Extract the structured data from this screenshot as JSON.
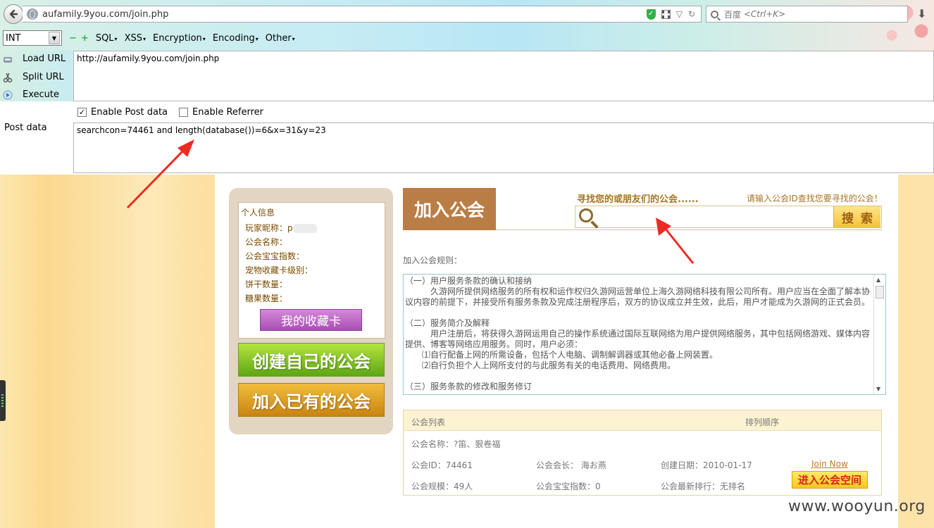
{
  "browser": {
    "url": "aufamily.9you.com/join.php",
    "search_placeholder_prefix": "百度",
    "search_placeholder_shortcut": "<Ctrl+K>"
  },
  "hackbar": {
    "select_value": "INT",
    "menus": [
      "SQL",
      "XSS",
      "Encryption",
      "Encoding",
      "Other"
    ],
    "load_url": "Load URL",
    "split_url": "Split URL",
    "execute": "Execute",
    "url_value": "http://aufamily.9you.com/join.php",
    "enable_post": "Enable Post data",
    "enable_referrer": "Enable Referrer",
    "post_label": "Post data",
    "post_value": "searchcon=74461 and length(database())=6&x=31&y=23",
    "enable_post_checked": true,
    "enable_referrer_checked": false
  },
  "left_panel": {
    "title": "个人信息",
    "nickname_label": "玩家昵称：",
    "nickname_value": "p",
    "guild_name": "公会名称：",
    "guild_baby_index": "公会宝宝指数：",
    "pet_card_level": "宠物收藏卡级别：",
    "biscuits": "饼干数量：",
    "candies": "糖果数量：",
    "my_card_button": "我的收藏卡",
    "create_guild_button": "创建自己的公会",
    "join_guild_button": "加入已有的公会"
  },
  "header": {
    "title": "加入公会",
    "find_text": "寻找您的或朋友们的公会......",
    "hint_text": "请输入公会ID查找您要寻找的公会！",
    "search_button": "搜索"
  },
  "rules": {
    "label": "加入公会规则：",
    "lines": [
      "（一）用户服务条款的确认和接纳",
      "　　　久游网所提供网络服务的所有权和运作权归久游网运营单位上海久游网络科技有限公司所有。用户应当在全面了解本协议内容的前提下，并接受所有服务条款及完成注册程序后，双方的协议成立并生效，此后，用户才能成为久游网的正式会员。",
      "",
      "（二）服务简介及解释",
      "　　　用户注册后，将获得久游网运用自己的操作系统通过国际互联网络为用户提供网络服务，其中包括网络游戏、媒体内容提供、博客等网络应用服务。同时，用户必须：",
      "　　⑴自行配备上网的所需设备，包括个人电脑、调制解调器或其他必备上网装置。",
      "　　⑵自行负担个人上网所支付的与此服务有关的电话费用、网络费用。",
      "",
      "（三）服务条款的修改和服务修订"
    ]
  },
  "guild_list": {
    "col_list": "公会列表",
    "col_order": "排列顺序",
    "name": "公会名称：?笛、狠卷福",
    "id": "公会ID：74461",
    "leader": "公会会长： 海お燕",
    "created": "创建日期：2010-01-17",
    "size": "公会规模：49人",
    "baby_index": "公会宝宝指数：0",
    "rank": "公会最新排行：无排名",
    "join_now": "Join Now",
    "enter_space": "进入公会空间"
  },
  "watermark": "www.wooyun.org",
  "colors": {
    "guild_title_bg": "#b97d45",
    "create_button": "#7ec429",
    "join_button": "#e0a228",
    "card_button": "#c06fc9",
    "annotation_arrow": "#ee2a24"
  }
}
